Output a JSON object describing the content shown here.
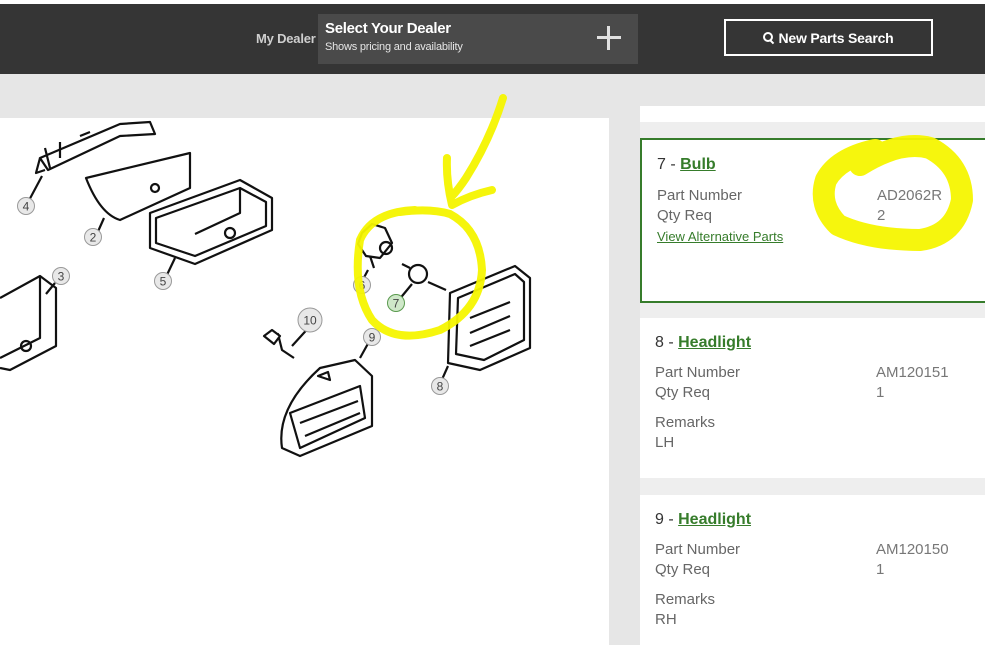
{
  "header": {
    "my_dealer_label": "My Dealer",
    "dealer_title": "Select Your Dealer",
    "dealer_subtitle": "Shows pricing and availability",
    "new_parts_search_label": "New Parts Search"
  },
  "diagram": {
    "callouts": [
      "4",
      "2",
      "5",
      "3",
      "6",
      "7",
      "10",
      "9",
      "8"
    ],
    "selected_callout": "7"
  },
  "parts": [
    {
      "num": "7 - ",
      "name": "Bulb",
      "part_number_label": "Part Number",
      "part_number": "AD2062R",
      "qty_label": "Qty Req",
      "qty": "2",
      "alt_link": "View Alternative Parts"
    },
    {
      "num": "8 - ",
      "name": "Headlight",
      "part_number_label": "Part Number",
      "part_number": "AM120151",
      "qty_label": "Qty Req",
      "qty": "1",
      "remarks_label": "Remarks",
      "remarks": "LH"
    },
    {
      "num": "9 - ",
      "name": "Headlight",
      "part_number_label": "Part Number",
      "part_number": "AM120150",
      "qty_label": "Qty Req",
      "qty": "1",
      "remarks_label": "Remarks",
      "remarks": "RH"
    }
  ],
  "colors": {
    "accent_green": "#367c2b",
    "annotation_yellow": "#f5f500",
    "header_bg": "#353535"
  }
}
